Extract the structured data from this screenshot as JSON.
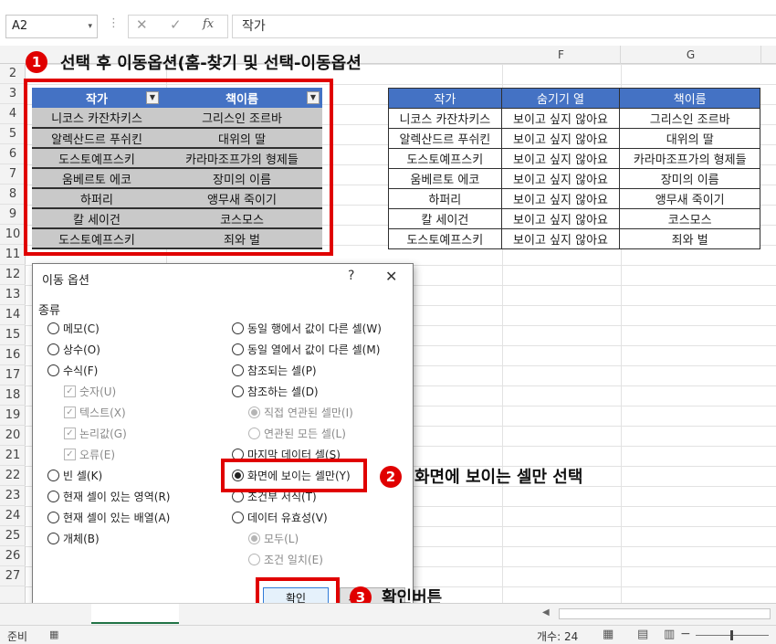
{
  "formula_bar": {
    "name_box": "A2",
    "name_box_arrow": "▾",
    "separator": "⋮",
    "cancel": "✕",
    "enter": "✓",
    "fx": "fx",
    "content": "작가"
  },
  "columns": [
    "F",
    "G"
  ],
  "rows": [
    "2",
    "3",
    "4",
    "5",
    "6",
    "7",
    "8",
    "9",
    "10",
    "11",
    "12",
    "13",
    "14",
    "15",
    "16",
    "17",
    "18",
    "19",
    "20",
    "21",
    "22",
    "23",
    "24",
    "25",
    "26",
    "27"
  ],
  "left_table": {
    "headers": [
      "작가",
      "책이름"
    ],
    "filter_icon": "▼",
    "rows": [
      [
        "니코스 카잔차키스",
        "그리스인 조르바"
      ],
      [
        "알렉산드르 푸쉬킨",
        "대위의 딸"
      ],
      [
        "도스토예프스키",
        "카라마조프가의 형제들"
      ],
      [
        "움베르토 에코",
        "장미의 이름"
      ],
      [
        "하퍼리",
        "앵무새 죽이기"
      ],
      [
        "칼 세이건",
        "코스모스"
      ],
      [
        "도스토예프스키",
        "죄와 벌"
      ]
    ]
  },
  "right_table": {
    "headers": [
      "작가",
      "숨기기 열",
      "책이름"
    ],
    "rows": [
      [
        "니코스 카잔차키스",
        "보이고 싶지 않아요",
        "그리스인 조르바"
      ],
      [
        "알렉산드르 푸쉬킨",
        "보이고 싶지 않아요",
        "대위의 딸"
      ],
      [
        "도스토예프스키",
        "보이고 싶지 않아요",
        "카라마조프가의 형제들"
      ],
      [
        "움베르토 에코",
        "보이고 싶지 않아요",
        "장미의 이름"
      ],
      [
        "하퍼리",
        "보이고 싶지 않아요",
        "앵무새 죽이기"
      ],
      [
        "칼 세이건",
        "보이고 싶지 않아요",
        "코스모스"
      ],
      [
        "도스토예프스키",
        "보이고 싶지 않아요",
        "죄와 벌"
      ]
    ]
  },
  "annotations": {
    "step1_badge": "1",
    "step1_text": "선택 후 이동옵션(홈-찾기 및 선택-이동옵션",
    "step2_badge": "2",
    "step2_text": "화면에 보이는 셀만 선택",
    "step3_badge": "3",
    "step3_text": "확인버튼"
  },
  "dialog": {
    "title": "이동 옵션",
    "help": "?",
    "close": "✕",
    "group_label": "종류",
    "left_options": [
      {
        "label": "메모(C)",
        "type": "radio",
        "checked": false,
        "disabled": false
      },
      {
        "label": "상수(O)",
        "type": "radio",
        "checked": false,
        "disabled": false
      },
      {
        "label": "수식(F)",
        "type": "radio",
        "checked": false,
        "disabled": false
      },
      {
        "label": "숫자(U)",
        "type": "checkbox",
        "checked": true,
        "disabled": true
      },
      {
        "label": "텍스트(X)",
        "type": "checkbox",
        "checked": true,
        "disabled": true
      },
      {
        "label": "논리값(G)",
        "type": "checkbox",
        "checked": true,
        "disabled": true
      },
      {
        "label": "오류(E)",
        "type": "checkbox",
        "checked": true,
        "disabled": true
      },
      {
        "label": "빈 셀(K)",
        "type": "radio",
        "checked": false,
        "disabled": false
      },
      {
        "label": "현재 셀이 있는 영역(R)",
        "type": "radio",
        "checked": false,
        "disabled": false
      },
      {
        "label": "현재 셀이 있는 배열(A)",
        "type": "radio",
        "checked": false,
        "disabled": false
      },
      {
        "label": "개체(B)",
        "type": "radio",
        "checked": false,
        "disabled": false
      }
    ],
    "right_options": [
      {
        "label": "동일 행에서 값이 다른 셀(W)",
        "type": "radio",
        "checked": false,
        "disabled": false
      },
      {
        "label": "동일 열에서 값이 다른 셀(M)",
        "type": "radio",
        "checked": false,
        "disabled": false
      },
      {
        "label": "참조되는 셀(P)",
        "type": "radio",
        "checked": false,
        "disabled": false
      },
      {
        "label": "참조하는 셀(D)",
        "type": "radio",
        "checked": false,
        "disabled": false
      },
      {
        "label": "직접 연관된 셀만(I)",
        "type": "radio",
        "checked": true,
        "disabled": true
      },
      {
        "label": "연관된 모든 셀(L)",
        "type": "radio",
        "checked": false,
        "disabled": true
      },
      {
        "label": "마지막 데이터 셀(S)",
        "type": "radio",
        "checked": false,
        "disabled": false
      },
      {
        "label": "화면에 보이는 셀만(Y)",
        "type": "radio",
        "checked": true,
        "disabled": false
      },
      {
        "label": "조건부 서식(T)",
        "type": "radio",
        "checked": false,
        "disabled": false
      },
      {
        "label": "데이터 유효성(V)",
        "type": "radio",
        "checked": false,
        "disabled": false
      },
      {
        "label": "모두(L)",
        "type": "radio",
        "checked": true,
        "disabled": true
      },
      {
        "label": "조건 일치(E)",
        "type": "radio",
        "checked": false,
        "disabled": true
      }
    ],
    "ok_label": "확인",
    "cancel_label_partial": "소"
  },
  "status_bar": {
    "ready": "준비",
    "count": "개수: 24",
    "view_normal_icon": "▦",
    "view_layout_icon": "▤",
    "view_pagebreak_icon": "▥",
    "zoom_minus": "−"
  },
  "sheet_bar": {
    "prev_arrow": "◀"
  }
}
